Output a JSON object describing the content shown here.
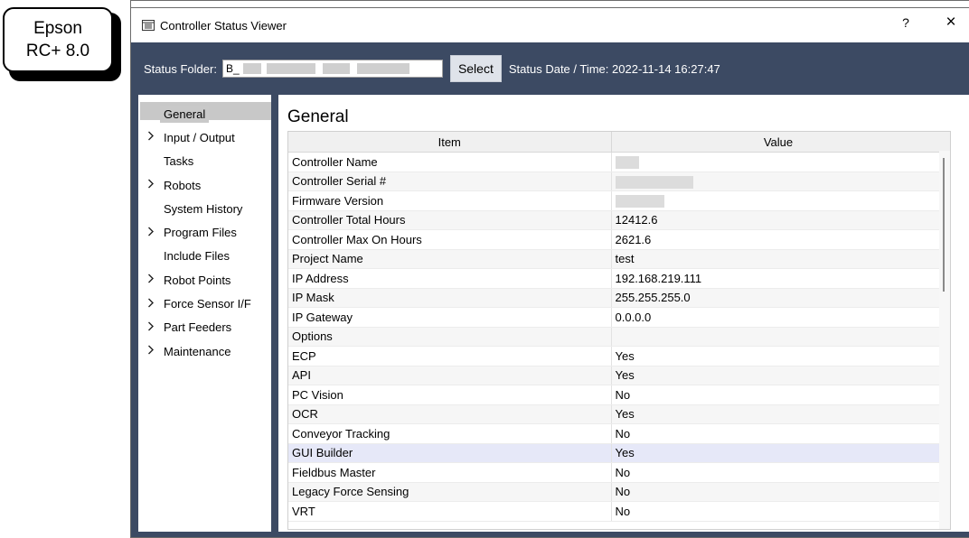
{
  "badge": {
    "line1": "Epson",
    "line2": "RC+ 8.0"
  },
  "window": {
    "title": "Controller Status Viewer",
    "help_label": "?",
    "close_label": "×"
  },
  "toolbar": {
    "folder_label": "Status Folder:",
    "folder_value": "B_",
    "select_label": "Select",
    "date_label": "Status Date / Time:",
    "date_value": "2022-11-14 16:27:47"
  },
  "sidebar": {
    "items": [
      {
        "label": "General",
        "expandable": false,
        "selected": true
      },
      {
        "label": "Input / Output",
        "expandable": true
      },
      {
        "label": "Tasks",
        "expandable": false
      },
      {
        "label": "Robots",
        "expandable": true
      },
      {
        "label": "System History",
        "expandable": false
      },
      {
        "label": "Program Files",
        "expandable": true
      },
      {
        "label": "Include Files",
        "expandable": false
      },
      {
        "label": "Robot Points",
        "expandable": true
      },
      {
        "label": "Force Sensor I/F",
        "expandable": true
      },
      {
        "label": "Part Feeders",
        "expandable": true
      },
      {
        "label": "Maintenance",
        "expandable": true
      }
    ]
  },
  "content": {
    "title": "General",
    "columns": [
      "Item",
      "Value"
    ],
    "rows": [
      {
        "item": "Controller Name",
        "value": ""
      },
      {
        "item": "Controller Serial #",
        "value": ""
      },
      {
        "item": "Firmware Version",
        "value": ""
      },
      {
        "item": "Controller Total Hours",
        "value": "12412.6"
      },
      {
        "item": "Controller Max On Hours",
        "value": "2621.6"
      },
      {
        "item": "Project Name",
        "value": "test"
      },
      {
        "item": "IP Address",
        "value": "192.168.219.111"
      },
      {
        "item": "IP Mask",
        "value": "255.255.255.0"
      },
      {
        "item": "IP Gateway",
        "value": "0.0.0.0"
      },
      {
        "item": "Options",
        "value": ""
      },
      {
        "item": "ECP",
        "value": "Yes"
      },
      {
        "item": "API",
        "value": "Yes"
      },
      {
        "item": "PC Vision",
        "value": "No"
      },
      {
        "item": "OCR",
        "value": "Yes"
      },
      {
        "item": "Conveyor Tracking",
        "value": "No"
      },
      {
        "item": "GUI Builder",
        "value": "Yes",
        "highlighted": true
      },
      {
        "item": "Fieldbus Master",
        "value": "No"
      },
      {
        "item": "Legacy Force Sensing",
        "value": "No"
      },
      {
        "item": "VRT",
        "value": "No"
      }
    ]
  },
  "colors": {
    "toolbar_bg": "#3c4a63",
    "selected_row": "#e6e8f8",
    "sidebar_selected": "#c8c8c8"
  },
  "icons": {
    "title": "list-window-icon",
    "expand": "chevron-right-icon",
    "help": "help-icon",
    "close": "close-icon"
  }
}
